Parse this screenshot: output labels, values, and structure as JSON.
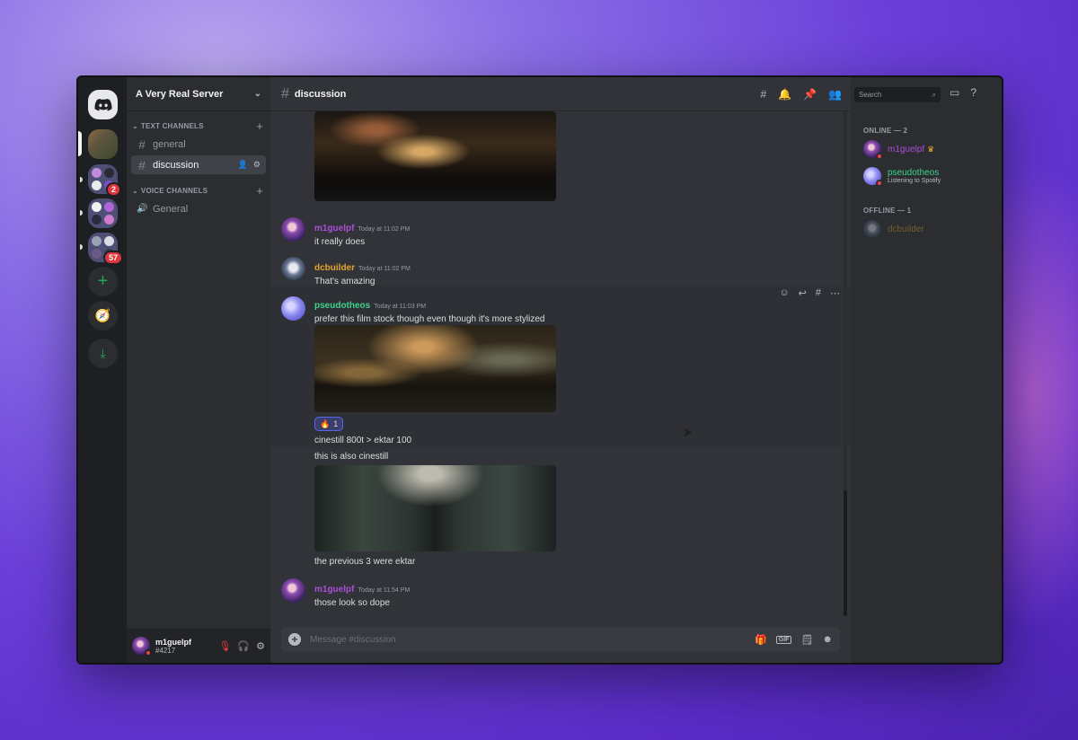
{
  "server": {
    "name": "A Very Real Server",
    "badges": [
      "2",
      "57"
    ]
  },
  "channels": {
    "text_category": "TEXT CHANNELS",
    "voice_category": "VOICE CHANNELS",
    "text": [
      "general",
      "discussion"
    ],
    "voice": [
      "General"
    ]
  },
  "user_panel": {
    "name": "m1guelpf",
    "tag": "#4217"
  },
  "header": {
    "channel": "discussion",
    "search_placeholder": "Search"
  },
  "messages": {
    "top_image_caption": "",
    "m1": {
      "author": "m1guelpf",
      "time": "Today at 11:02 PM",
      "text": "it really does"
    },
    "m2": {
      "author": "dcbuilder",
      "time": "Today at 11:02 PM",
      "text": "That's amazing"
    },
    "m3": {
      "author": "pseudotheos",
      "time": "Today at 11:03 PM",
      "text": "prefer this film stock though even though it's more stylized",
      "reaction": {
        "emoji": "🔥",
        "count": "1"
      },
      "followups": [
        "cinestill 800t > ektar 100",
        "this is also cinestill",
        "the previous 3 were ektar"
      ]
    },
    "m4": {
      "author": "m1guelpf",
      "time": "Today at 11:54 PM",
      "text": "those look so dope"
    }
  },
  "composer": {
    "placeholder": "Message #discussion"
  },
  "members": {
    "online_header": "ONLINE — 2",
    "offline_header": "OFFLINE — 1",
    "online": [
      {
        "name": "m1guelpf",
        "crown": "♛"
      },
      {
        "name": "pseudotheos",
        "activity": "Listening to Spotify"
      }
    ],
    "offline": [
      {
        "name": "dcbuilder"
      }
    ]
  },
  "colors": {
    "m1guelpf": "#a94fd6",
    "dcbuilder": "#e0a52c",
    "pseudotheos": "#3fd38a",
    "accent": "#5865f2"
  }
}
